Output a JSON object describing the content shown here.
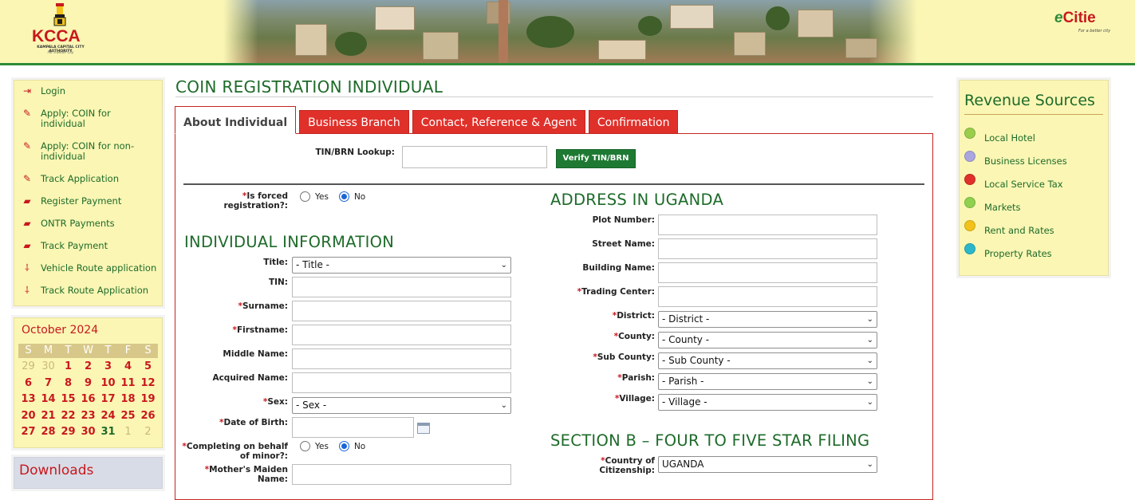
{
  "header": {
    "kcca_logo_text": "KCCA",
    "kcca_subtitle": "KAMPALA CAPITAL CITY AUTHORITY",
    "kcca_tagline": "For a better City",
    "ecitie_logo_text": "Citie",
    "ecitie_e": "e",
    "ecitie_tagline": "For a better city"
  },
  "menu": {
    "items": [
      {
        "label": "Login",
        "icon": "login-icon"
      },
      {
        "label": "Apply: COIN for individual",
        "icon": "edit-icon"
      },
      {
        "label": "Apply: COIN for non-individual",
        "icon": "edit-icon"
      },
      {
        "label": "Track Application",
        "icon": "edit-icon"
      },
      {
        "label": "Register Payment",
        "icon": "payment-icon"
      },
      {
        "label": "ONTR Payments",
        "icon": "payment-icon"
      },
      {
        "label": "Track Payment",
        "icon": "payment-icon"
      },
      {
        "label": "Vehicle Route application",
        "icon": "route-icon"
      },
      {
        "label": "Track Route Application",
        "icon": "route-icon"
      }
    ]
  },
  "calendar": {
    "title": "October 2024",
    "weekdays": [
      "S",
      "M",
      "T",
      "W",
      "T",
      "F",
      "S"
    ],
    "days": [
      {
        "d": "29",
        "t": "other"
      },
      {
        "d": "30",
        "t": "other"
      },
      {
        "d": "1",
        "t": ""
      },
      {
        "d": "2",
        "t": ""
      },
      {
        "d": "3",
        "t": ""
      },
      {
        "d": "4",
        "t": ""
      },
      {
        "d": "5",
        "t": ""
      },
      {
        "d": "6",
        "t": ""
      },
      {
        "d": "7",
        "t": ""
      },
      {
        "d": "8",
        "t": ""
      },
      {
        "d": "9",
        "t": ""
      },
      {
        "d": "10",
        "t": ""
      },
      {
        "d": "11",
        "t": ""
      },
      {
        "d": "12",
        "t": ""
      },
      {
        "d": "13",
        "t": ""
      },
      {
        "d": "14",
        "t": ""
      },
      {
        "d": "15",
        "t": ""
      },
      {
        "d": "16",
        "t": ""
      },
      {
        "d": "17",
        "t": ""
      },
      {
        "d": "18",
        "t": ""
      },
      {
        "d": "19",
        "t": ""
      },
      {
        "d": "20",
        "t": ""
      },
      {
        "d": "21",
        "t": ""
      },
      {
        "d": "22",
        "t": ""
      },
      {
        "d": "23",
        "t": ""
      },
      {
        "d": "24",
        "t": ""
      },
      {
        "d": "25",
        "t": ""
      },
      {
        "d": "26",
        "t": ""
      },
      {
        "d": "27",
        "t": ""
      },
      {
        "d": "28",
        "t": ""
      },
      {
        "d": "29",
        "t": ""
      },
      {
        "d": "30",
        "t": ""
      },
      {
        "d": "31",
        "t": "today"
      },
      {
        "d": "1",
        "t": "other"
      },
      {
        "d": "2",
        "t": "other"
      }
    ]
  },
  "downloads": {
    "title": "Downloads"
  },
  "revenue": {
    "title": "Revenue Sources",
    "items": [
      {
        "label": "Local Hotel",
        "color": "#9acd4c"
      },
      {
        "label": "Business Licenses",
        "color": "#a9a6e0"
      },
      {
        "label": "Local Service Tax",
        "color": "#e0302a"
      },
      {
        "label": "Markets",
        "color": "#8fd14f"
      },
      {
        "label": "Rent and Rates",
        "color": "#f2c21b"
      },
      {
        "label": "Property Rates",
        "color": "#2bb7c9"
      }
    ]
  },
  "main": {
    "title": "COIN REGISTRATION INDIVIDUAL",
    "tabs": [
      {
        "label": "About Individual",
        "active": true
      },
      {
        "label": "Business Branch",
        "active": false
      },
      {
        "label": "Contact, Reference & Agent",
        "active": false
      },
      {
        "label": "Confirmation",
        "active": false
      }
    ],
    "lookup": {
      "label": "TIN/BRN Lookup:",
      "value": "",
      "verify_label": "Verify TIN/BRN"
    },
    "forced": {
      "label": "Is forced registration?:",
      "yes": "Yes",
      "no": "No",
      "selected": "No"
    },
    "individual": {
      "heading": "INDIVIDUAL INFORMATION",
      "title_label": "Title:",
      "title_value": "- Title -",
      "tin_label": "TIN:",
      "surname_label": "Surname:",
      "firstname_label": "Firstname:",
      "middlename_label": "Middle Name:",
      "acquired_label": "Acquired Name:",
      "sex_label": "Sex:",
      "sex_value": "- Sex -",
      "dob_label": "Date of Birth:",
      "minor_label": "Completing on behalf of minor?:",
      "minor_yes": "Yes",
      "minor_no": "No",
      "minor_selected": "No",
      "maiden_label": "Mother's Maiden Name:"
    },
    "address": {
      "heading": "ADDRESS IN UGANDA",
      "plot_label": "Plot Number:",
      "street_label": "Street Name:",
      "building_label": "Building Name:",
      "trading_label": "Trading Center:",
      "district_label": "District:",
      "district_value": "- District -",
      "county_label": "County:",
      "county_value": "- County -",
      "subcounty_label": "Sub County:",
      "subcounty_value": "- Sub County -",
      "parish_label": "Parish:",
      "parish_value": "- Parish -",
      "village_label": "Village:",
      "village_value": "- Village -"
    },
    "sectionb": {
      "heading": "SECTION B – FOUR TO FIVE STAR FILING",
      "citizenship_label": "Country of Citizenship:",
      "citizenship_value": "UGANDA"
    }
  }
}
